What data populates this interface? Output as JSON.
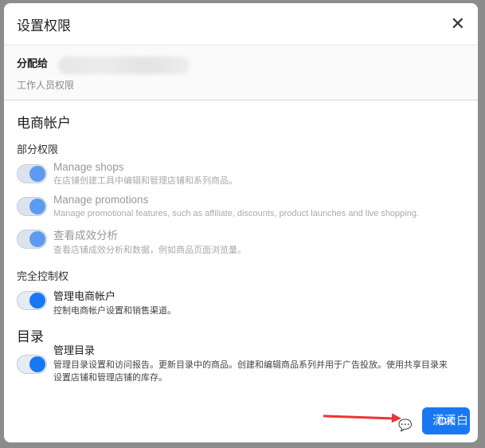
{
  "dialog": {
    "title": "设置权限",
    "close": "✕"
  },
  "assign": {
    "label": "分配给",
    "subtitle": "工作人员权限"
  },
  "section1": {
    "title": "电商帐户",
    "partial": "部分权限",
    "full": "完全控制权",
    "items": [
      {
        "name": "Manage shops",
        "desc": "在店铺创建工具中编辑和管理店铺和系列商品。",
        "enabled": true,
        "disabled": true
      },
      {
        "name": "Manage promotions",
        "desc": "Manage promotional features, such as affiliate, discounts, product launches and live shopping.",
        "enabled": true,
        "disabled": true
      },
      {
        "name": "查看成效分析",
        "desc": "查看店铺成效分析和数据，例如商品页面浏览量。",
        "enabled": true,
        "disabled": true
      }
    ],
    "full_item": {
      "name": "管理电商帐户",
      "desc": "控制电商帐户设置和销售渠道。",
      "enabled": true
    }
  },
  "section2": {
    "title": "目录",
    "item": {
      "name": "管理目录",
      "desc": "管理目录设置和访问报告。更新目录中的商品。创建和编辑商品系列并用于广告投放。使用共享目录来设置店铺和管理店铺的库存。",
      "enabled": true
    }
  },
  "footer": {
    "ok": "OK",
    "watermark": "潇潇白"
  }
}
